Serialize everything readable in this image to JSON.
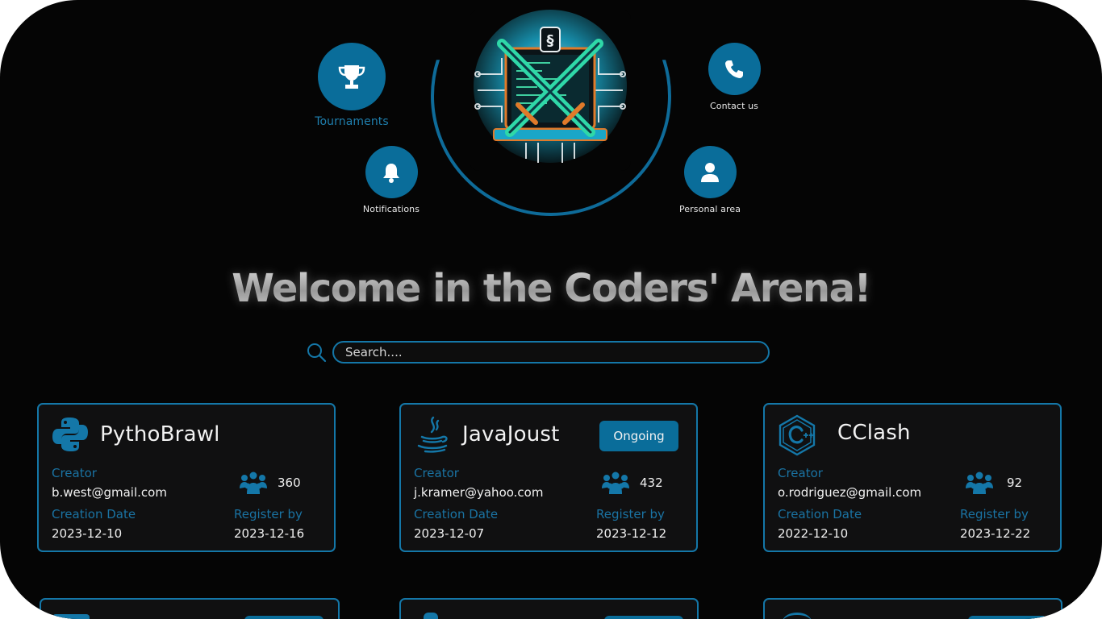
{
  "nav": {
    "tournaments": "Tournaments",
    "notifications": "Notifications",
    "contact": "Contact us",
    "personal": "Personal area"
  },
  "heading": "Welcome in the Coders' Arena!",
  "search": {
    "placeholder": "Search....",
    "value": ""
  },
  "labels": {
    "creator": "Creator",
    "creation_date": "Creation Date",
    "register_by": "Register  by"
  },
  "cards": [
    {
      "title": "PythoBrawl",
      "icon": "python-icon",
      "creator": "b.west@gmail.com",
      "participants": "360",
      "creation_date": "2023-12-10",
      "register_by": "2023-12-16",
      "badge": ""
    },
    {
      "title": "JavaJoust",
      "icon": "java-icon",
      "creator": "j.kramer@yahoo.com",
      "participants": "432",
      "creation_date": "2023-12-07",
      "register_by": "2023-12-12",
      "badge": "Ongoing"
    },
    {
      "title": "CClash",
      "icon": "cpp-icon",
      "creator": "o.rodriguez@gmail.com",
      "participants": "92",
      "creation_date": "2022-12-10",
      "register_by": "2023-12-22",
      "badge": ""
    }
  ],
  "colors": {
    "accent": "#0a6d9a",
    "border": "#1477a8",
    "background": "#050505"
  }
}
